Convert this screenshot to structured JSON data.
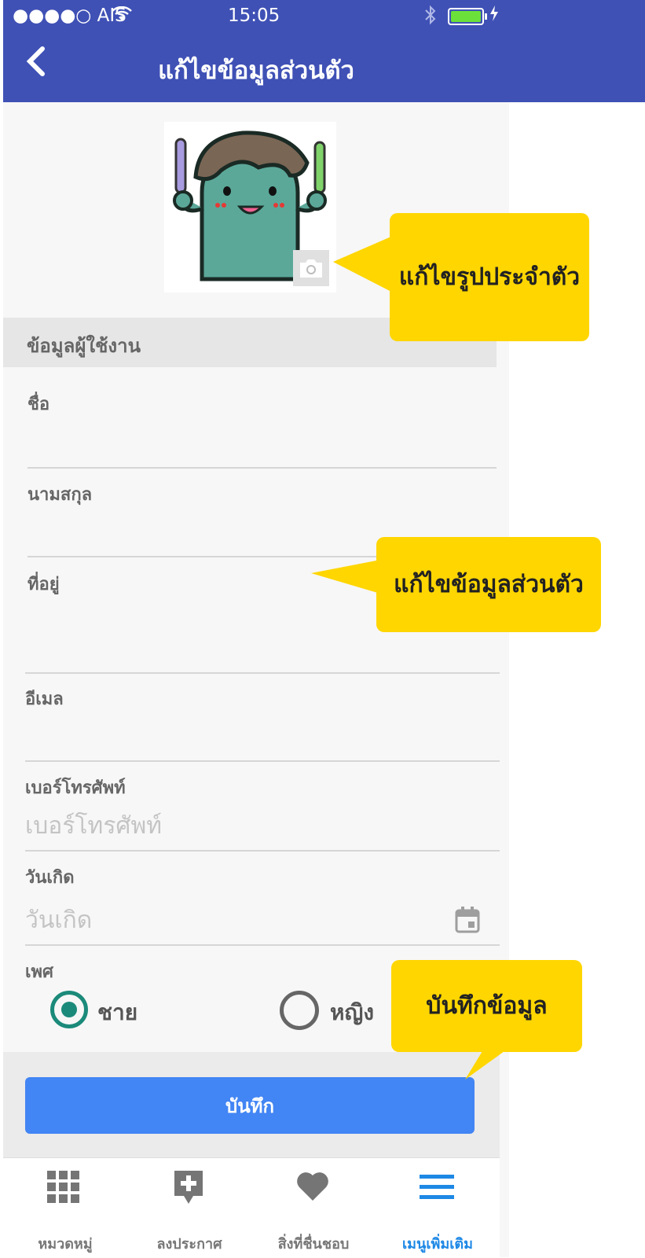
{
  "status_bar": {
    "carrier": "●●●●○ AIS",
    "time": "15:05"
  },
  "navbar": {
    "back_icon": "chevron-left-icon",
    "title": "แก้ไขข้อมูลส่วนตัว"
  },
  "profile": {
    "avatar_icon": "cartoon-avatar",
    "camera_icon": "camera-icon"
  },
  "section": {
    "title": "ข้อมูลผู้ใช้งาน"
  },
  "form": {
    "first_name": {
      "label": "ชื่อ",
      "value": ""
    },
    "last_name": {
      "label": "นามสกุล",
      "value": ""
    },
    "address": {
      "label": "ที่อยู่",
      "value": ""
    },
    "email": {
      "label": "อีเมล",
      "value": ""
    },
    "phone": {
      "label": "เบอร์โทรศัพท์",
      "placeholder": "เบอร์โทรศัพท์"
    },
    "birthday": {
      "label": "วันเกิด",
      "placeholder": "วันเกิด",
      "icon": "calendar-icon"
    },
    "gender": {
      "label": "เพศ",
      "options": [
        {
          "label": "ชาย",
          "selected": true
        },
        {
          "label": "หญิง",
          "selected": false
        }
      ]
    }
  },
  "save_button": {
    "label": "บันทึก"
  },
  "tabbar": {
    "tabs": [
      {
        "label": "หมวดหมู่",
        "icon": "grid-icon",
        "active": false
      },
      {
        "label": "ลงประกาศ",
        "icon": "add-post-icon",
        "active": false
      },
      {
        "label": "สิ่งที่ชื่นชอบ",
        "icon": "heart-icon",
        "active": false
      },
      {
        "label": "เมนูเพิ่มเติม",
        "icon": "menu-icon",
        "active": true
      }
    ]
  },
  "callouts": {
    "photo": "แก้ไขรูปประจำตัว",
    "info": "แก้ไขข้อมูลส่วนตัว",
    "save": "บันทึกข้อมูล"
  },
  "colors": {
    "header": "#3f51b5",
    "accent_blue": "#4285f4",
    "radio_green": "#1b8a7a",
    "callout_yellow": "#ffd600",
    "tab_active": "#1e88e5"
  }
}
